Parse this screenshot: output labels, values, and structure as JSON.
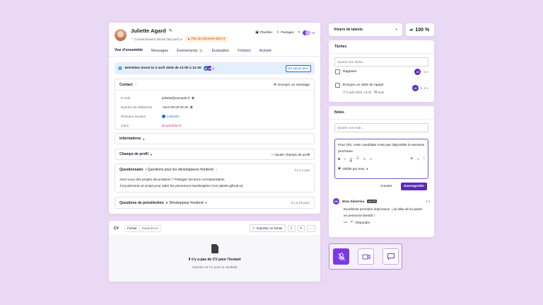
{
  "candidate": {
    "name": "Juliette Agard",
    "consent": "Consentement donné (50 jours)",
    "eeo_badge": "Pas de données EEO",
    "actions": {
      "plan": "Planifier",
      "share": "Partager",
      "more_count": "+5"
    }
  },
  "tabs": [
    {
      "label": "Vue d'ensemble",
      "active": true
    },
    {
      "label": "Messages"
    },
    {
      "label": "Événements",
      "count": "1"
    },
    {
      "label": "Évaluation"
    },
    {
      "label": "Fichiers"
    },
    {
      "label": "Activité"
    }
  ],
  "banner": {
    "text": "Entretien Zoom le 3 avril 2025 de 12:00 à 12:30",
    "avatars": [
      "JO",
      "JG"
    ],
    "extra": "4",
    "button": "En savoir plus"
  },
  "contact": {
    "title": "Contact",
    "send_message": "Envoyer un message",
    "fields": [
      {
        "label": "E-mail",
        "value": "juliette@exemple.fr"
      },
      {
        "label": "Numéro de téléphone",
        "value": "+33 6 00 00 00 00"
      },
      {
        "label": "Réseaux sociaux",
        "value": "LinkedIn"
      },
      {
        "label": "Liens",
        "value": "lienportfolio.fr"
      }
    ]
  },
  "informations": {
    "title": "Informations"
  },
  "profile_fields": {
    "title": "Champs de profil",
    "add": "Ajouter champs de profil"
  },
  "questionnaire": {
    "title": "Questionnaire",
    "subtitle": "• Questions pour les développeurs frontend",
    "time": "Il y a 1 jour",
    "question": "Avez-vous des projets secondaires ? Partagez les liens correspondants",
    "answer": "J'ai justement un projet pour aider les personnes handicapées (voir juliette.github.io)"
  },
  "preselection": {
    "title": "Questions de présélection",
    "subtitle": "Développeur frontend",
    "time": "Il y a 10 jours"
  },
  "cv": {
    "title": "CV",
    "tabs": [
      "Fichier",
      "Expérience"
    ],
    "import": "Importer un fichier",
    "empty_title": "Il n'y a pas de CV pour l'instant",
    "empty_sub": "Importer un CV pour ce candidat"
  },
  "right": {
    "pools": "Viviers de talents",
    "score": "100 %",
    "tasks": {
      "title": "Tâches",
      "placeholder": "Ajouter une tâche...",
      "items": [
        {
          "label": "Rappeler",
          "avatar": "JO",
          "due": "1 s"
        },
        {
          "label": "Envoyer un SMS de rappel",
          "meta_date": "3 avril 2025, 12:00",
          "meta_note": "Note",
          "avatar": "JO",
          "due": "1 s"
        }
      ]
    },
    "notes": {
      "title": "Notes",
      "placeholder": "Ajouter une note...",
      "draft": "Pour info, cette candidate n'est pas disponible la semaine prochaine",
      "visibility": "Visible par tous",
      "cancel": "Annuler",
      "save": "Sauvegarder",
      "comment": {
        "avatar": "NS",
        "author": "Nina Simeriou",
        "badge": "INVITÉ",
        "time": "2 s",
        "text": "Excellente première impression - j'ai hâte de lui parler en personne bientôt !",
        "reply": "Répondre"
      }
    }
  },
  "colors": {
    "accent": "#5b2bb5",
    "background": "#ead9f5",
    "banner": "#e5effc",
    "link": "#1e6fd9",
    "pink_link": "#d6337a",
    "eeo": "#b8520c"
  }
}
